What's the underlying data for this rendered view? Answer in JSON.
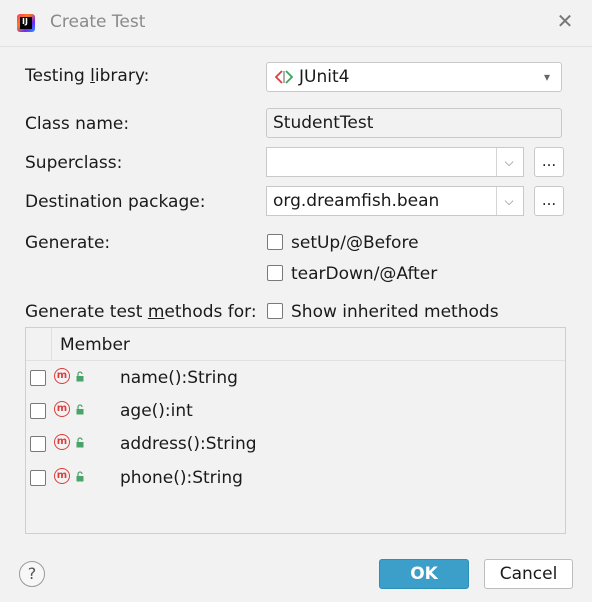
{
  "window": {
    "title": "Create Test",
    "icon": "intellij-idea-icon"
  },
  "form": {
    "testing_library": {
      "label_before": "Testing ",
      "label_mnemonic": "l",
      "label_after": "ibrary:",
      "value": "JUnit4",
      "icon": "junit-icon"
    },
    "class_name": {
      "label": "Class name:",
      "value": "StudentTest"
    },
    "superclass": {
      "label": "Superclass:",
      "value": "",
      "browse_label": "..."
    },
    "destination_package": {
      "label": "Destination package:",
      "value": "org.dreamfish.bean",
      "browse_label": "..."
    },
    "generate": {
      "label": "Generate:",
      "options": [
        {
          "label": "setUp/@Before",
          "checked": false
        },
        {
          "label": "tearDown/@After",
          "checked": false
        }
      ]
    },
    "generate_methods": {
      "label_before": "Generate test ",
      "label_mnemonic": "m",
      "label_after": "ethods for:",
      "show_inherited": {
        "label": "Show inherited methods",
        "checked": false
      }
    }
  },
  "members_table": {
    "header": "Member",
    "rows": [
      {
        "name": "name():String",
        "checked": false
      },
      {
        "name": "age():int",
        "checked": false
      },
      {
        "name": "address():String",
        "checked": false
      },
      {
        "name": "phone():String",
        "checked": false
      }
    ]
  },
  "footer": {
    "help_label": "?",
    "ok_label": "OK",
    "cancel_label": "Cancel"
  },
  "colors": {
    "accent": "#3c9fc9",
    "method_icon": "#d93f3f",
    "lock_icon": "#4aa36b"
  }
}
